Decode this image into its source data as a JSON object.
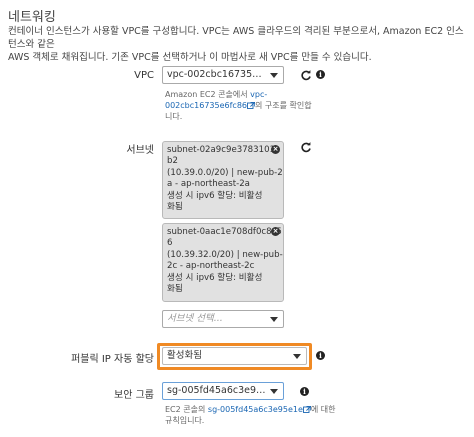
{
  "section": {
    "title": "네트워킹",
    "description_line1": "컨테이너 인스턴스가 사용할 VPC를 구성합니다. VPC는 AWS 클라우드의 격리된 부분으로서, Amazon EC2 인스턴스와 같은",
    "description_line2": "AWS 객체로 채워집니다. 기존 VPC를 선택하거나 이 마법사로 새 VPC를 만들 수 있습니다."
  },
  "vpc": {
    "label": "VPC",
    "selected": "vpc-002cbc16735e6fc86",
    "help_prefix": "Amazon EC2 콘솔에서 ",
    "help_link_a": "vpc-",
    "help_link_b": "002cbc16735e6fc86",
    "help_suffix": "의 구조를 확인합니다."
  },
  "subnets": {
    "label": "서브넷",
    "items": [
      {
        "lines": [
          "subnet-02a9c9e3783101a",
          "b2",
          "(10.39.0.0/20) | new-pub-2",
          "a - ap-northeast-2a",
          "생성 시 ipv6 할당: 비활성",
          "화됨"
        ]
      },
      {
        "lines": [
          "subnet-0aac1e708df0c8c5",
          "6",
          "(10.39.32.0/20) | new-pub-",
          "2c - ap-northeast-2c",
          "생성 시 ipv6 할당: 비활성",
          "화됨"
        ]
      }
    ],
    "placeholder": "서브넷 선택..."
  },
  "public_ip": {
    "label": "퍼블릭 IP 자동 할당",
    "selected": "활성화됨"
  },
  "security_group": {
    "label": "보안 그룹",
    "selected": "sg-005fd45a6c3e95e1e",
    "help_prefix": "EC2 콘솔의 ",
    "help_link": "sg-005fd45a6c3e95e1e",
    "help_suffix": "에 대한",
    "help_line2": "규칙입니다."
  },
  "colors": {
    "highlight": "#f08a24",
    "link": "#1a66b3"
  },
  "icons": {
    "refresh": "refresh-icon",
    "info": "info-icon",
    "external": "external-link-icon",
    "remove": "close-icon"
  }
}
